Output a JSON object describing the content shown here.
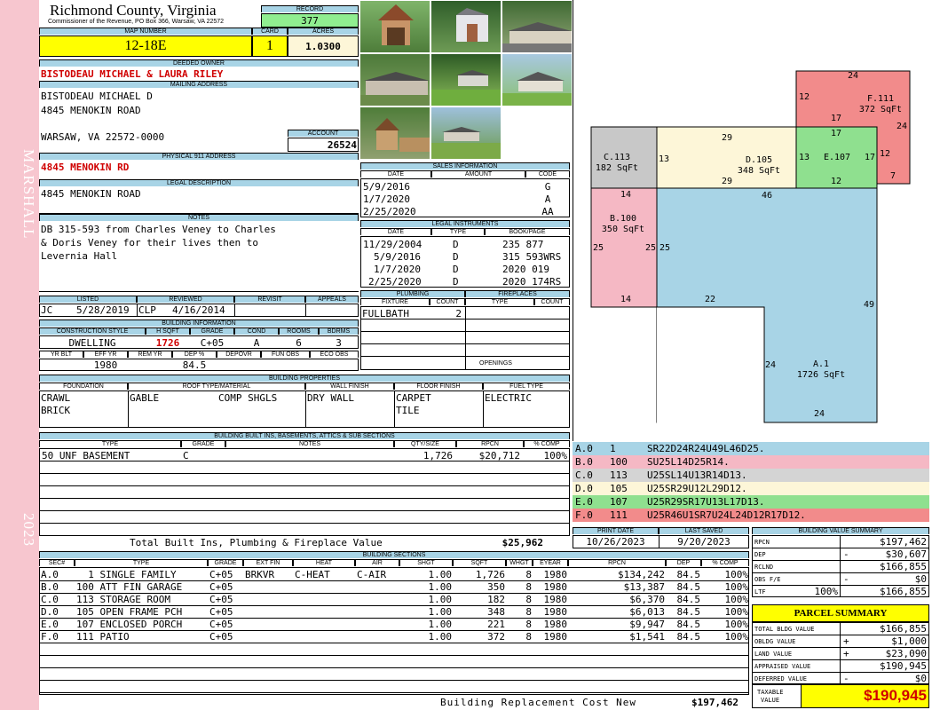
{
  "sidebar": {
    "district": "MARSHALL",
    "year": "2023"
  },
  "header": {
    "county": "Richmond County, Virginia",
    "subtitle": "Commissioner of the Revenue, PO Box 366, Warsaw, VA 22572",
    "record_label": "RECORD",
    "record": "377",
    "map_label": "MAP NUMBER",
    "map": "12-18E",
    "card_label": "CARD",
    "card": "1",
    "acres_label": "ACRES",
    "acres": "1.0300"
  },
  "owner": {
    "deeded_label": "DEEDED OWNER",
    "deeded": "BISTODEAU MICHAEL & LAURA RILEY",
    "mailing_label": "MAILING ADDRESS",
    "mail1": "BISTODEAU MICHAEL D",
    "mail2": "4845 MENOKIN ROAD",
    "mail3": "WARSAW, VA 22572-0000",
    "account_label": "ACCOUNT",
    "account": "26524",
    "phys_label": "PHYSICAL 911 ADDRESS",
    "phys": "4845 MENOKIN RD",
    "legal_label": "LEGAL DESCRIPTION",
    "legal": "4845 MENOKIN ROAD",
    "notes_label": "NOTES",
    "notes1": "DB 315-593 from Charles Veney to Charles",
    "notes2": "& Doris Veney for their lives then to",
    "notes3": "Levernia Hall"
  },
  "review": {
    "listed_label": "LISTED",
    "reviewed_label": "REVIEWED",
    "revisit_label": "REVISIT",
    "appeals_label": "APPEALS",
    "listed_by": "JC",
    "listed_date": "5/28/2019",
    "reviewed_by": "CLP",
    "reviewed_date": "4/16/2014"
  },
  "building_info": {
    "label": "BUILDING INFORMATION",
    "h1": "CONSTRUCTION STYLE",
    "h2": "H SQFT",
    "h3": "GRADE",
    "h4": "COND",
    "h5": "ROOMS",
    "h6": "BDRMS",
    "style": "DWELLING",
    "hsqft": "1726",
    "grade": "C+05",
    "cond": "A",
    "rooms": "6",
    "bdrms": "3",
    "h7": "YR BLT",
    "h8": "EFF YR",
    "h9": "REM YR",
    "h10": "DEP %",
    "h11": "DEPOVR",
    "h12": "FUN OBS",
    "h13": "ECO OBS",
    "eff_yr": "1980",
    "dep": "84.5"
  },
  "sales": {
    "label": "SALES INFORMATION",
    "h_date": "DATE",
    "h_amount": "AMOUNT",
    "h_code": "CODE",
    "rows": [
      {
        "date": "5/9/2016",
        "code": "G"
      },
      {
        "date": "1/7/2020",
        "code": "A"
      },
      {
        "date": "2/25/2020",
        "code": "AA"
      }
    ]
  },
  "legal_instr": {
    "label": "LEGAL INSTRUMENTS",
    "h_date": "DATE",
    "h_type": "TYPE",
    "h_book": "BOOK/PAGE",
    "rows": [
      {
        "date": "11/29/2004",
        "type": "D",
        "book": "235 877"
      },
      {
        "date": "5/9/2016",
        "type": "D",
        "book": "315 593WRS"
      },
      {
        "date": "1/7/2020",
        "type": "D",
        "book": "2020 019"
      },
      {
        "date": "2/25/2020",
        "type": "D",
        "book": "2020 174RS"
      }
    ]
  },
  "plumbing": {
    "label": "PLUMBING",
    "h_fixture": "FIXTURE",
    "h_count": "COUNT",
    "fixture": "FULLBATH",
    "count": "2"
  },
  "fireplaces": {
    "label": "FIREPLACES",
    "h_type": "TYPE",
    "h_count": "COUNT",
    "openings": "OPENINGS"
  },
  "props": {
    "label": "BUILDING PROPERTIES",
    "h_found": "FOUNDATION",
    "h_roof": "ROOF TYPE/MATERIAL",
    "h_wall": "WALL FINISH",
    "h_floor": "FLOOR FINISH",
    "h_fuel": "FUEL TYPE",
    "found1": "CRAWL",
    "found2": "BRICK",
    "roof1": "GABLE",
    "roof2": "COMP SHGLS",
    "wall": "DRY WALL",
    "floor1": "CARPET",
    "floor2": "TILE",
    "fuel": "ELECTRIC"
  },
  "builtins": {
    "label": "BUILDING BUILT INS, BASEMENTS, ATTICS & SUB SECTIONS",
    "h_type": "TYPE",
    "h_grade": "GRADE",
    "h_notes": "NOTES",
    "h_qty": "QTY/SIZE",
    "h_rpcn": "RPCN",
    "h_comp": "% COMP",
    "row": {
      "type": "50 UNF BASEMENT",
      "grade": "C",
      "qty": "1,726",
      "rpcn": "$20,712",
      "comp": "100%"
    },
    "total_label": "Total Built Ins, Plumbing & Fireplace Value",
    "total": "$25,962"
  },
  "sections": {
    "label": "BUILDING SECTIONS",
    "h": [
      "SEC#",
      "TYPE",
      "GRADE",
      "EXT FIN",
      "HEAT",
      "AIR",
      "SHGT",
      "SQFT",
      "WHGT",
      "EYEAR",
      "RPCN",
      "DEP",
      "% COMP"
    ],
    "rows": [
      {
        "sec": "A.0",
        "type": "  1 SINGLE FAMILY",
        "grade": "C+05",
        "ext": "BRKVR",
        "heat": "C-HEAT",
        "air": "C-AIR",
        "shgt": "1.00",
        "sqft": "1,726",
        "whgt": "8",
        "eyear": "1980",
        "rpcn": "$134,242",
        "dep": "84.5",
        "comp": "100%"
      },
      {
        "sec": "B.0",
        "type": "100 ATT FIN GARAGE",
        "grade": "C+05",
        "ext": "",
        "heat": "",
        "air": "",
        "shgt": "1.00",
        "sqft": "350",
        "whgt": "8",
        "eyear": "1980",
        "rpcn": "$13,387",
        "dep": "84.5",
        "comp": "100%"
      },
      {
        "sec": "C.0",
        "type": "113 STORAGE ROOM",
        "grade": "C+05",
        "ext": "",
        "heat": "",
        "air": "",
        "shgt": "1.00",
        "sqft": "182",
        "whgt": "8",
        "eyear": "1980",
        "rpcn": "$6,370",
        "dep": "84.5",
        "comp": "100%"
      },
      {
        "sec": "D.0",
        "type": "105 OPEN FRAME PCH",
        "grade": "C+05",
        "ext": "",
        "heat": "",
        "air": "",
        "shgt": "1.00",
        "sqft": "348",
        "whgt": "8",
        "eyear": "1980",
        "rpcn": "$6,013",
        "dep": "84.5",
        "comp": "100%"
      },
      {
        "sec": "E.0",
        "type": "107 ENCLOSED PORCH",
        "grade": "C+05",
        "ext": "",
        "heat": "",
        "air": "",
        "shgt": "1.00",
        "sqft": "221",
        "whgt": "8",
        "eyear": "1980",
        "rpcn": "$9,947",
        "dep": "84.5",
        "comp": "100%"
      },
      {
        "sec": "F.0",
        "type": "111 PATIO",
        "grade": "C+05",
        "ext": "",
        "heat": "",
        "air": "",
        "shgt": "1.00",
        "sqft": "372",
        "whgt": "8",
        "eyear": "1980",
        "rpcn": "$1,541",
        "dep": "84.5",
        "comp": "100%"
      }
    ],
    "total_label": "Building Replacement Cost New",
    "total": "$197,462"
  },
  "sketch": {
    "labels": {
      "c": "C.113\n182 SqFt",
      "d": "D.105\n348 SqFt",
      "e": "E.107",
      "f": "F.111\n372 SqFt",
      "b": "B.100\n350 SqFt",
      "a": "A.1\n1726 SqFt"
    },
    "dims": [
      "24",
      "12",
      "17",
      "24",
      "7",
      "12",
      "13",
      "13",
      "17",
      "17",
      "12",
      "29",
      "29",
      "46",
      "14",
      "25",
      "25",
      "25",
      "14",
      "22",
      "49",
      "24",
      "24"
    ],
    "colors": {
      "a": "#a8d4e6",
      "b": "#f5b8c4",
      "c": "#c8c8c8",
      "d": "#fdf6d8",
      "e": "#8fe08f",
      "f": "#f28b8b"
    }
  },
  "sketch_rows": [
    {
      "id": "A.0",
      "n": "1",
      "code": "SR22D24R24U49L46D25.",
      "color": "#a8d4e6"
    },
    {
      "id": "B.0",
      "n": "100",
      "code": "SU25L14D25R14.",
      "color": "#f5b8c4"
    },
    {
      "id": "C.0",
      "n": "113",
      "code": "U25SL14U13R14D13.",
      "color": "#d4d4d4"
    },
    {
      "id": "D.0",
      "n": "105",
      "code": "U25SR29U12L29D12.",
      "color": "#fdf6d8"
    },
    {
      "id": "E.0",
      "n": "107",
      "code": "U25R29SR17U13L17D13.",
      "color": "#8fe08f"
    },
    {
      "id": "F.0",
      "n": "111",
      "code": "U25R46U1SR7U24L24D12R17D12.",
      "color": "#f28b8b"
    }
  ],
  "print": {
    "print_label": "PRINT DATE",
    "saved_label": "LAST SAVED",
    "print_date": "10/26/2023",
    "saved": "9/20/2023"
  },
  "bvs": {
    "label": "BUILDING VALUE SUMMARY",
    "rpcn_l": "RPCN",
    "rpcn": "$197,462",
    "dep_l": "DEP",
    "dep_s": "-",
    "dep": "$30,607",
    "rclnd_l": "RCLND",
    "rclnd": "$166,855",
    "obs_l": "OBS F/E",
    "obs_s": "-",
    "obs": "$0",
    "ltf_l": "LTF",
    "ltf_p": "100%",
    "ltf": "$166,855"
  },
  "parcel": {
    "label": "PARCEL SUMMARY",
    "tbv_l": "TOTAL BLDG VALUE",
    "tbv": "$166,855",
    "ob_l": "OBLDG VALUE",
    "ob_s": "+",
    "ob": "$1,000",
    "land_l": "LAND VALUE",
    "land_s": "+",
    "land": "$23,090",
    "appr_l": "APPRAISED VALUE",
    "appr": "$190,945",
    "def_l": "DEFERRED VALUE",
    "def_s": "-",
    "def": "$0",
    "tax_l1": "TAXABLE",
    "tax_l2": "VALUE",
    "tax": "$190,945"
  }
}
